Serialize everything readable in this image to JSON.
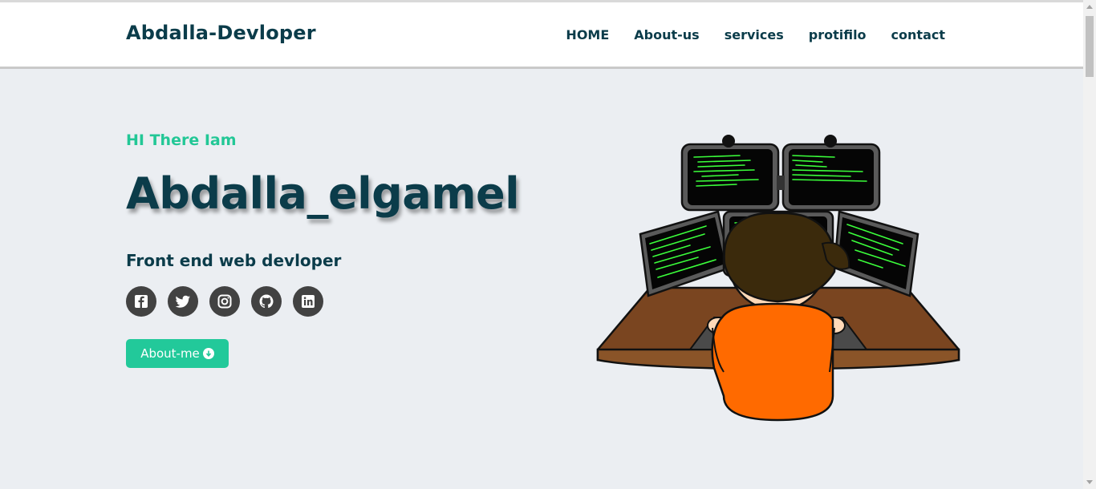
{
  "header": {
    "brand": "Abdalla-Devloper",
    "nav": [
      "HOME",
      "About-us",
      "services",
      "protifilo",
      "contact"
    ]
  },
  "hero": {
    "greeting": "HI There Iam",
    "name": "Abdalla_elgamel",
    "role": "Front end web devloper",
    "socials": [
      "facebook-icon",
      "twitter-icon",
      "instagram-icon",
      "github-icon",
      "linkedin-icon"
    ],
    "button_label": "About-me"
  },
  "colors": {
    "accent": "#22c99a",
    "primary_text": "#0b3c4a",
    "background": "#ebeef2",
    "social_bg": "#424242"
  }
}
